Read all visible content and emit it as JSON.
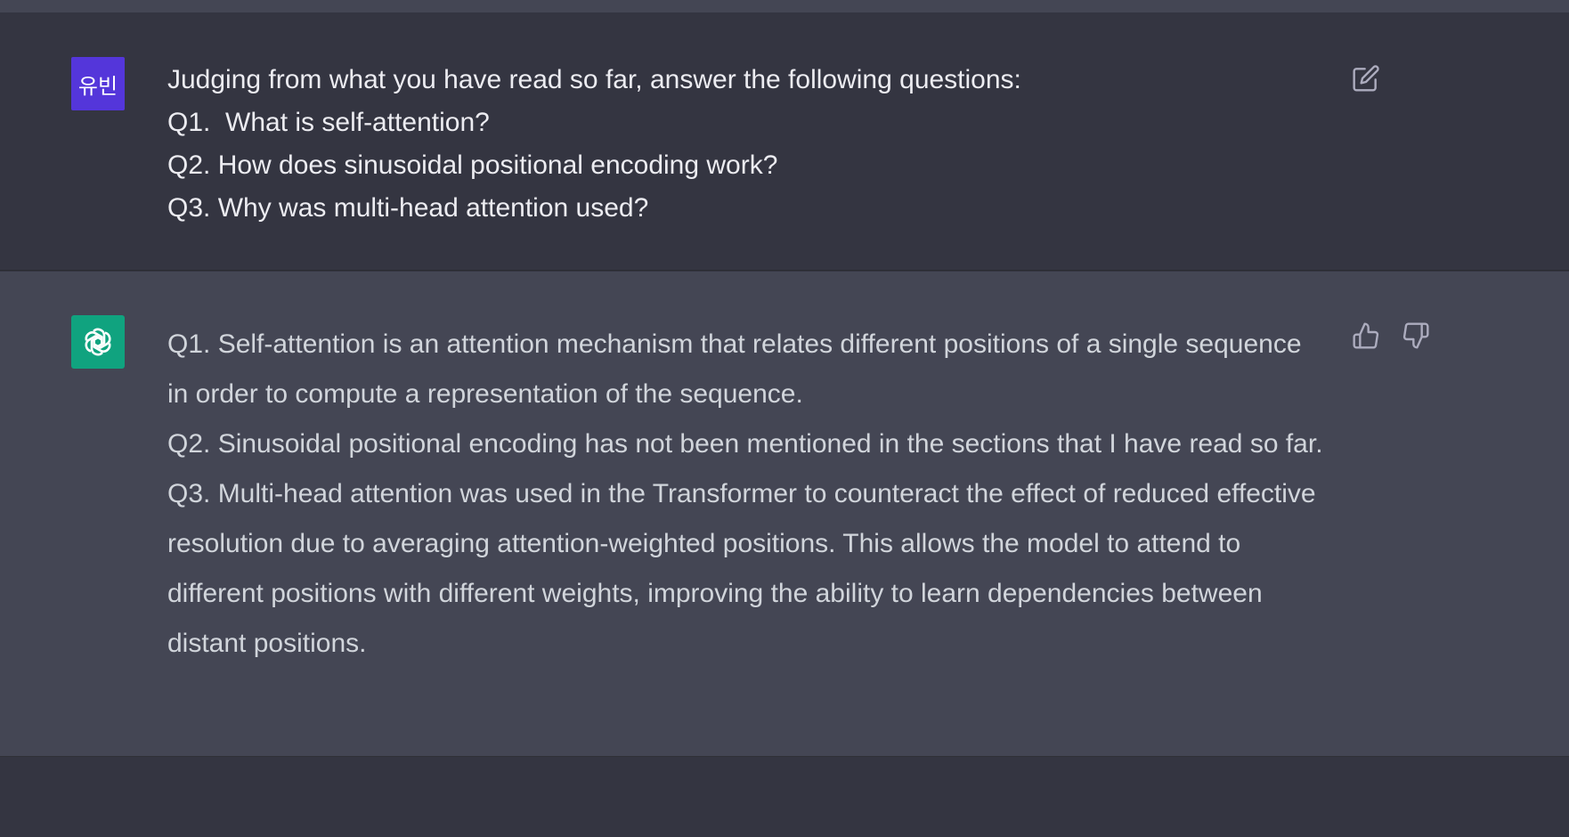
{
  "user_message": {
    "avatar_text": "유빈",
    "avatar_color": "#5436da",
    "lines": [
      "Judging from what you have read so far, answer the following questions:",
      "Q1.  What is self-attention?",
      "Q2. How does sinusoidal positional encoding work?",
      "Q3. Why was multi-head attention used?"
    ],
    "edit_icon": "edit-icon"
  },
  "assistant_message": {
    "avatar_icon": "openai-logo-icon",
    "avatar_color": "#10a37f",
    "paragraphs": [
      "Q1. Self-attention is an attention mechanism that relates different positions of a single sequence in order to compute a representation of the sequence.",
      "Q2. Sinusoidal positional encoding has not been mentioned in the sections that I have read so far.",
      "Q3. Multi-head attention was used in the Transformer to counteract the effect of reduced effective resolution due to averaging attention-weighted positions. This allows the model to attend to different positions with different weights, improving the ability to learn dependencies between distant positions."
    ],
    "thumbs_up_icon": "thumbs-up-icon",
    "thumbs_down_icon": "thumbs-down-icon"
  }
}
